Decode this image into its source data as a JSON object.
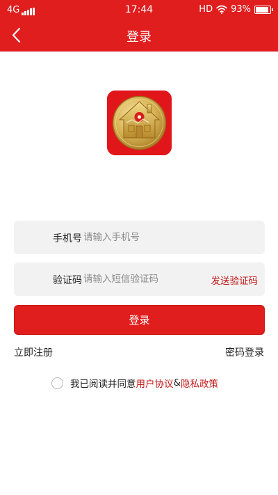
{
  "status_bar": {
    "network": "4G",
    "time": "17:44",
    "hd": "HD",
    "battery_percent": "93%",
    "battery_level": 0.93
  },
  "header": {
    "title": "登录"
  },
  "form": {
    "phone": {
      "label": "手机号",
      "placeholder": "请输入手机号",
      "value": ""
    },
    "code": {
      "label": "验证码",
      "placeholder": "请输入短信验证码",
      "value": "",
      "send_label": "发送验证码"
    },
    "submit_label": "登录"
  },
  "links": {
    "register": "立即注册",
    "password_login": "密码登录"
  },
  "agreement": {
    "prefix": "我已阅读并同意",
    "user_agreement": "用户协议",
    "separator": "&",
    "privacy_policy": "隐私政策",
    "checked": false
  },
  "icons": {
    "back": "chevron-left-icon",
    "logo": "app-logo-house-coin",
    "wifi": "wifi-icon",
    "battery": "battery-icon",
    "signal": "signal-icon"
  },
  "colors": {
    "brand_red": "#e01e1e",
    "link_red": "#c21818",
    "field_bg": "#f2f2f2"
  }
}
